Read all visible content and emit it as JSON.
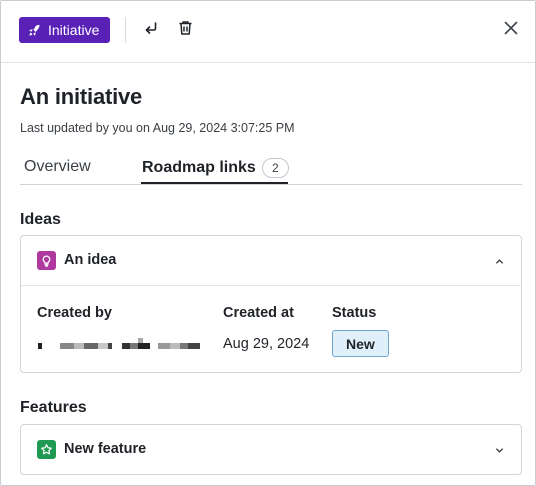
{
  "header": {
    "record_type_label": "Initiative",
    "record_type_icon": "rocket-icon",
    "accent_color": "#5a21b6",
    "actions": [
      "return-icon",
      "trash-icon",
      "close-icon"
    ]
  },
  "record": {
    "title": "An initiative",
    "last_updated": "Last updated by you on Aug 29, 2024 3:07:25 PM"
  },
  "tabs": [
    {
      "label": "Overview",
      "active": false
    },
    {
      "label": "Roadmap links",
      "count": "2",
      "active": true
    }
  ],
  "sections": {
    "ideas": {
      "label": "Ideas",
      "items": [
        {
          "title": "An idea",
          "icon": "lightbulb-icon",
          "icon_color": "#b0399f",
          "expanded": true,
          "columns": {
            "created_by_label": "Created by",
            "created_at_label": "Created at",
            "status_label": "Status"
          },
          "created_at": "Aug 29, 2024",
          "status": "New",
          "status_color": "#e0f0fb"
        }
      ]
    },
    "features": {
      "label": "Features",
      "items": [
        {
          "title": "New feature",
          "icon": "star-icon",
          "icon_color": "#1f9a52",
          "expanded": false
        }
      ]
    }
  }
}
